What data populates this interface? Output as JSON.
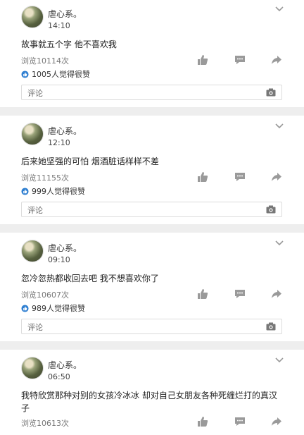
{
  "posts": [
    {
      "name": "虐心系。",
      "time": "14:10",
      "content": "故事就五个字 他不喜欢我",
      "views": "浏览10114次",
      "likes": "1005人觉得很赞",
      "comment_placeholder": "评论"
    },
    {
      "name": "虐心系。",
      "time": "12:10",
      "content": "后来她坚强的可怕 烟酒脏话样样不差",
      "views": "浏览11155次",
      "likes": "999人觉得很赞",
      "comment_placeholder": "评论"
    },
    {
      "name": "虐心系。",
      "time": "09:10",
      "content": "忽冷忽热都收回去吧 我不想喜欢你了",
      "views": "浏览10607次",
      "likes": "989人觉得很赞",
      "comment_placeholder": "评论"
    },
    {
      "name": "虐心系。",
      "time": "06:50",
      "content": "我特欣赏那种对别的女孩冷冰冰 却对自己女朋友各种死缠烂打的真汉子",
      "views": "浏览10613次"
    }
  ],
  "icons": {
    "chevron": "chevron-down-icon",
    "like": "thumbs-up-icon",
    "comment": "comment-icon",
    "share": "share-icon",
    "camera": "camera-icon",
    "liked_badge": "thumbs-up-badge-icon"
  },
  "colors": {
    "accent": "#2f7fd1",
    "icon_gray": "#9a9a9a",
    "divider": "#eeeeee"
  }
}
